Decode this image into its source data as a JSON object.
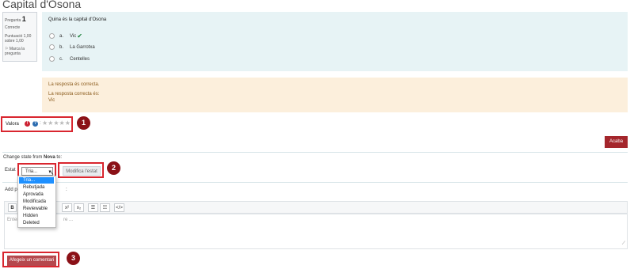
{
  "page": {
    "title": "Capital d'Osona"
  },
  "question_info": {
    "label": "Pregunta",
    "number": "1",
    "state": "Correcte",
    "marks": "Puntuació 1,00 sobre 1,00",
    "flag": "Marca la pregunta"
  },
  "question": {
    "text": "Quina és la capital d'Osona",
    "options": [
      {
        "letter": "a.",
        "text": "Vic",
        "correct": true
      },
      {
        "letter": "b.",
        "text": "La Garrotxa",
        "correct": false
      },
      {
        "letter": "c.",
        "text": "Centelles",
        "correct": false
      }
    ]
  },
  "feedback": {
    "line1": "La resposta és correcta.",
    "line2": "La resposta correcta és:",
    "line3": "Vic"
  },
  "rating": {
    "label": "Valora",
    "stars": "★★★★★",
    "colon": ":"
  },
  "badges": [
    "1",
    "2",
    "3"
  ],
  "actions": {
    "finish": "Acaba"
  },
  "state_change": {
    "prefix": "Change state from",
    "from": "Nova",
    "suffix": "to:",
    "estat_label": "Estat",
    "selected": "Tria...",
    "modify_button": "Modifica l'estat",
    "options": [
      "Tria...",
      "Rebutjada",
      "Aprovada",
      "Modificada",
      "Reviewable",
      "Hidden",
      "Deleted"
    ]
  },
  "comment": {
    "heading_start": "Add pu",
    "heading_end": ":",
    "placeholder_start": "Enter y",
    "placeholder_end": "re ...",
    "add_button": "Afegeix un comentari"
  },
  "toolbar": {
    "bold": "B",
    "sup": "x²",
    "sub": "x₂",
    "ul": "☰",
    "ol": "☷",
    "code": "</>"
  },
  "colors": {
    "accent": "#a4262c",
    "highlight": "#d9262f",
    "question_bg": "#e7f3f5",
    "feedback_bg": "#fcefdc"
  }
}
